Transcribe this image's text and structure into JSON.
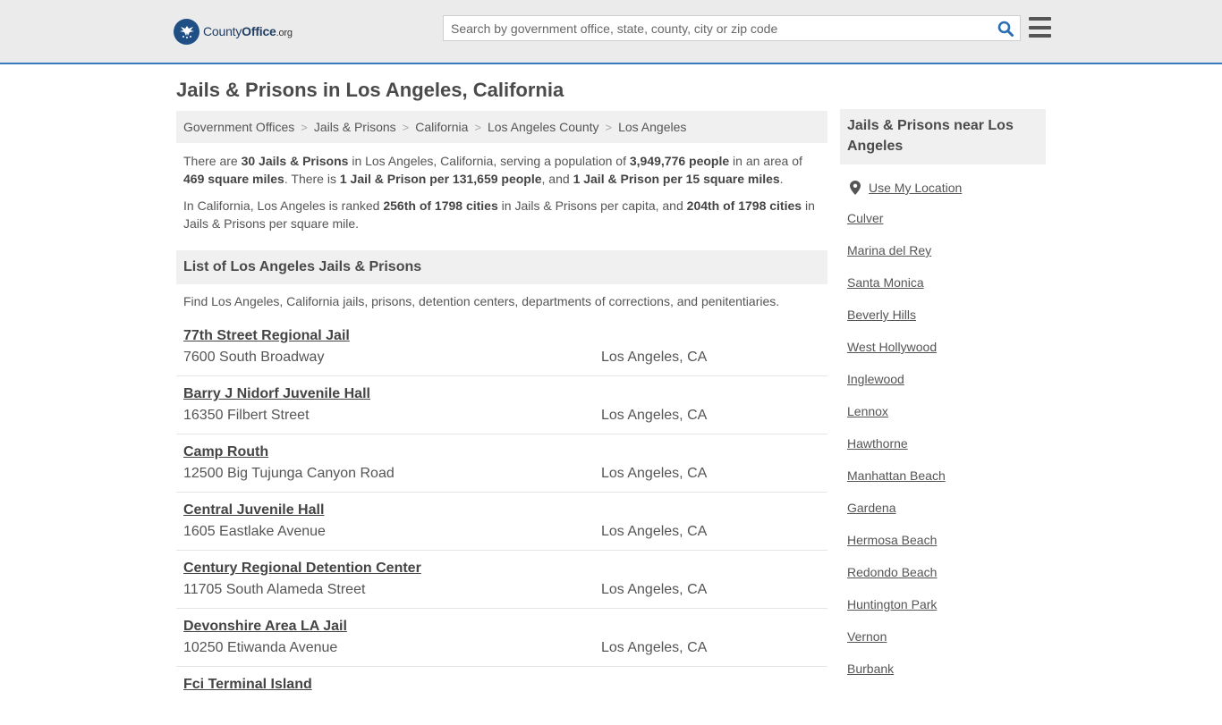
{
  "header": {
    "logo_text_main": "County",
    "logo_text_bold": "Office",
    "logo_text_tld": ".org",
    "search_placeholder": "Search by government office, state, county, city or zip code",
    "search_icon": "search-icon",
    "menu_icon": "hamburger-menu-icon",
    "accent_color": "#3a7bbf"
  },
  "page": {
    "title": "Jails & Prisons in Los Angeles, California"
  },
  "breadcrumb": [
    "Government Offices",
    "Jails & Prisons",
    "California",
    "Los Angeles County",
    "Los Angeles"
  ],
  "intro": {
    "p1_a": "There are ",
    "p1_b": "30 Jails & Prisons",
    "p1_c": " in Los Angeles, California, serving a population of ",
    "p1_d": "3,949,776 people",
    "p1_e": " in an area of ",
    "p1_f": "469 square miles",
    "p1_g": ". There is ",
    "p1_h": "1 Jail & Prison per 131,659 people",
    "p1_i": ", and ",
    "p1_j": "1 Jail & Prison per 15 square miles",
    "p1_k": ".",
    "p2_a": "In California, Los Angeles is ranked ",
    "p2_b": "256th of 1798 cities",
    "p2_c": " in Jails & Prisons per capita, and ",
    "p2_d": "204th of 1798 cities",
    "p2_e": " in Jails & Prisons per square mile."
  },
  "list_section": {
    "title": "List of Los Angeles Jails & Prisons",
    "description": "Find Los Angeles, California jails, prisons, detention centers, departments of corrections, and penitentiaries.",
    "items": [
      {
        "name": "77th Street Regional Jail",
        "address": "7600 South Broadway",
        "city": "Los Angeles, CA"
      },
      {
        "name": "Barry J Nidorf Juvenile Hall",
        "address": "16350 Filbert Street",
        "city": "Los Angeles, CA"
      },
      {
        "name": "Camp Routh",
        "address": "12500 Big Tujunga Canyon Road",
        "city": "Los Angeles, CA"
      },
      {
        "name": "Central Juvenile Hall",
        "address": "1605 Eastlake Avenue",
        "city": "Los Angeles, CA"
      },
      {
        "name": "Century Regional Detention Center",
        "address": "11705 South Alameda Street",
        "city": "Los Angeles, CA"
      },
      {
        "name": "Devonshire Area LA Jail",
        "address": "10250 Etiwanda Avenue",
        "city": "Los Angeles, CA"
      },
      {
        "name": "Fci Terminal Island",
        "address": "",
        "city": ""
      }
    ]
  },
  "sidebar": {
    "title": "Jails & Prisons near Los Angeles",
    "use_location": "Use My Location",
    "pin_icon": "map-pin-icon",
    "links": [
      "Culver",
      "Marina del Rey",
      "Santa Monica",
      "Beverly Hills",
      "West Hollywood",
      "Inglewood",
      "Lennox",
      "Hawthorne",
      "Manhattan Beach",
      "Gardena",
      "Hermosa Beach",
      "Redondo Beach",
      "Huntington Park",
      "Vernon",
      "Burbank"
    ]
  }
}
